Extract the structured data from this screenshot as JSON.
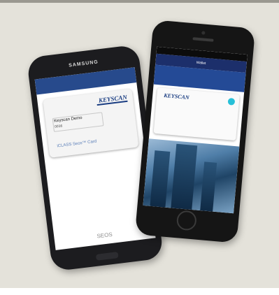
{
  "samsung": {
    "brand": "SAMSUNG",
    "card": {
      "logo": "KEYSCAN",
      "name": "Keyscan Demo",
      "number": "0016",
      "type": "iCLASS Seos™ Card"
    },
    "footer": "SEOS"
  },
  "iphone": {
    "app_title": "Wallet",
    "card": {
      "logo": "KEYSCAN"
    }
  },
  "colors": {
    "background": "#e4e2da",
    "brand_blue": "#274a8c",
    "accent_badge": "#27c0d8"
  }
}
